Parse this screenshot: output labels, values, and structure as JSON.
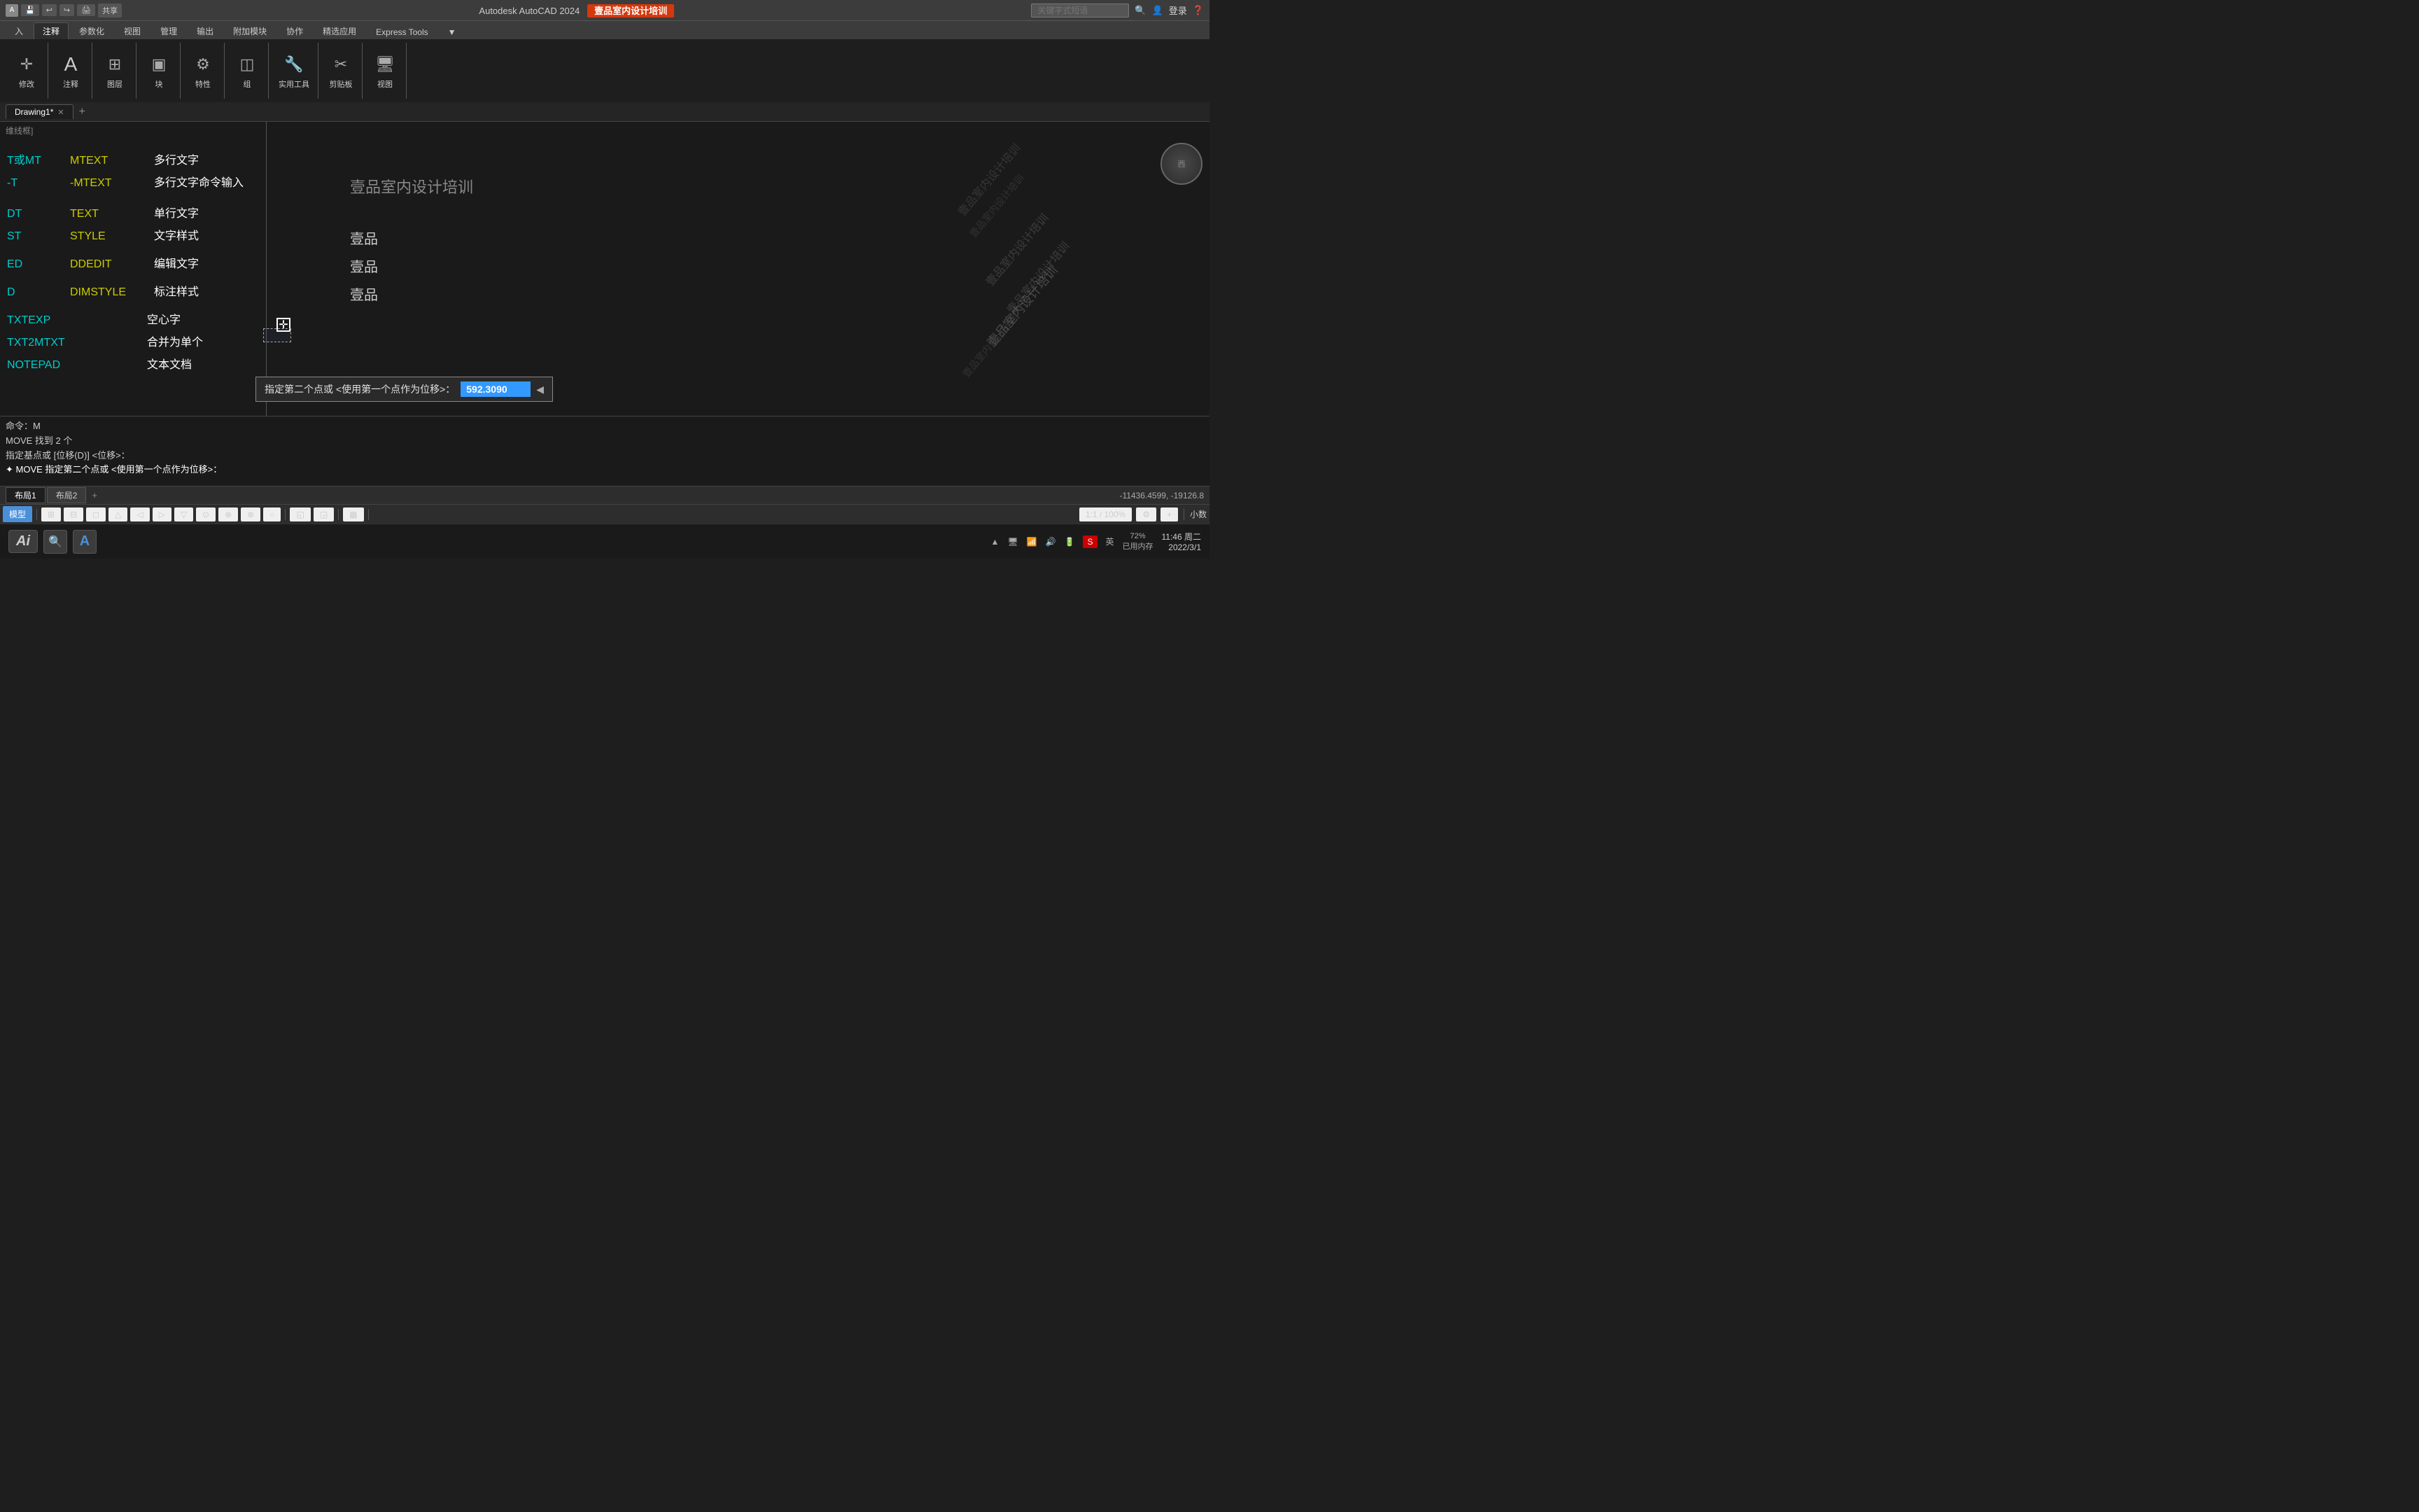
{
  "titleBar": {
    "icons": [
      "save",
      "undo",
      "redo",
      "print",
      "share"
    ],
    "title": "Autodesk AutoCAD 2024",
    "brand": "壹品室内设计培训",
    "searchPlaceholder": "关键字式短语",
    "loginLabel": "登录",
    "helpLabel": "?"
  },
  "ribbon": {
    "tabs": [
      "入",
      "注释",
      "参数化",
      "视图",
      "管理",
      "输出",
      "附加模块",
      "协作",
      "精选应用",
      "Express Tools"
    ],
    "activeTab": "注释",
    "groups": [
      {
        "label": "修改",
        "items": [
          {
            "icon": "✛",
            "label": "修改"
          }
        ]
      },
      {
        "label": "注释",
        "items": [
          {
            "icon": "A",
            "label": "注释"
          }
        ]
      },
      {
        "label": "图层",
        "items": [
          {
            "icon": "⊞",
            "label": "图层"
          }
        ]
      },
      {
        "label": "块",
        "items": [
          {
            "icon": "▣",
            "label": "块"
          }
        ]
      },
      {
        "label": "特性",
        "items": [
          {
            "icon": "🔧",
            "label": "特性"
          }
        ]
      },
      {
        "label": "组",
        "items": [
          {
            "icon": "◫",
            "label": "组"
          }
        ]
      },
      {
        "label": "实用工具",
        "items": [
          {
            "icon": "⚙",
            "label": "实用工具"
          }
        ]
      },
      {
        "label": "剪贴板",
        "items": [
          {
            "icon": "📋",
            "label": "剪贴板"
          }
        ]
      },
      {
        "label": "视图",
        "items": [
          {
            "icon": "🖥",
            "label": "视图"
          }
        ]
      }
    ]
  },
  "docTabs": [
    {
      "label": "Drawing1*",
      "active": true
    }
  ],
  "viewportLabel": "维线框]",
  "canvasContent": {
    "commands": [
      {
        "col1": "T或MT",
        "col2": "MTEXT",
        "col3": "多行文字",
        "col1Color": "cyan",
        "col2Color": "yellow",
        "col3Color": "white"
      },
      {
        "col1": "-T",
        "col2": "-MTEXT",
        "col3": "多行文字命令输入",
        "col1Color": "cyan",
        "col2Color": "yellow",
        "col3Color": "white"
      },
      {
        "col1": "DT",
        "col2": "TEXT",
        "col3": "单行文字",
        "col1Color": "cyan",
        "col2Color": "yellow",
        "col3Color": "white"
      },
      {
        "col1": "ST",
        "col2": "STYLE",
        "col3": "文字样式",
        "col1Color": "cyan",
        "col2Color": "yellow",
        "col3Color": "white"
      },
      {
        "col1": "ED",
        "col2": "DDEDIT",
        "col3": "编辑文字",
        "col1Color": "cyan",
        "col2Color": "yellow",
        "col3Color": "white"
      },
      {
        "col1": "D",
        "col2": "DIMSTYLE",
        "col3": "标注样式",
        "col1Color": "cyan",
        "col2Color": "yellow",
        "col3Color": "white"
      },
      {
        "col1": "TXTEXP",
        "col2": "",
        "col3": "空心字",
        "col1Color": "cyan",
        "col3Color": "white"
      },
      {
        "col1": "TXT2MTXT",
        "col2": "",
        "col3": "合并为单个",
        "col1Color": "cyan",
        "col3Color": "white"
      },
      {
        "col1": "NOTEPAD",
        "col2": "",
        "col3": "文本文档",
        "col1Color": "cyan",
        "col3Color": "white"
      }
    ],
    "rightLabels": [
      "壹品",
      "壹品",
      "壹品"
    ],
    "bigText": "壹品室内设计培训",
    "watermarks": [
      "壹品室内设计培训",
      "壹品室内设计培训",
      "壹品室内设计培训",
      "壹品室内设计培训",
      "壹品室内设计培训",
      "壹品室内设计培训"
    ]
  },
  "tooltip": {
    "label": "指定第二个点或 <使用第一个点作为位移>：",
    "value": "592.3090"
  },
  "commandArea": {
    "lines": [
      "MOVE  找到  2  个",
      "指定基点或  [位移(D)]  <位移>："
    ],
    "moveText": "✦ MOVE 指定第二个点或 <使用第一个点作为位移>：",
    "prompt": "命令：M"
  },
  "statusBar": {
    "layouts": [
      "布局1",
      "布局2"
    ],
    "coords": "-11436.4599, -19126.8"
  },
  "bottomToolbar": {
    "buttons": [
      "模型",
      "⊞",
      "⊟",
      "◻",
      "△",
      "◁",
      "▷",
      "▽",
      "⊙",
      "⊕",
      "⊗",
      "○",
      "◱",
      "◲",
      "▦",
      "◧",
      "⊡",
      "◈",
      "⊘",
      "1:1 / 100%",
      "⚙",
      "小数"
    ],
    "activeBtn": "模型",
    "rightLabel": "小数"
  },
  "systemTray": {
    "aiBadge": "Ai",
    "memoryPercent": "72%",
    "memoryLabel": "已用内存",
    "time": "11:46 周二",
    "date": "2022/3/1",
    "inputIcon": "A",
    "langIcon": "英"
  }
}
